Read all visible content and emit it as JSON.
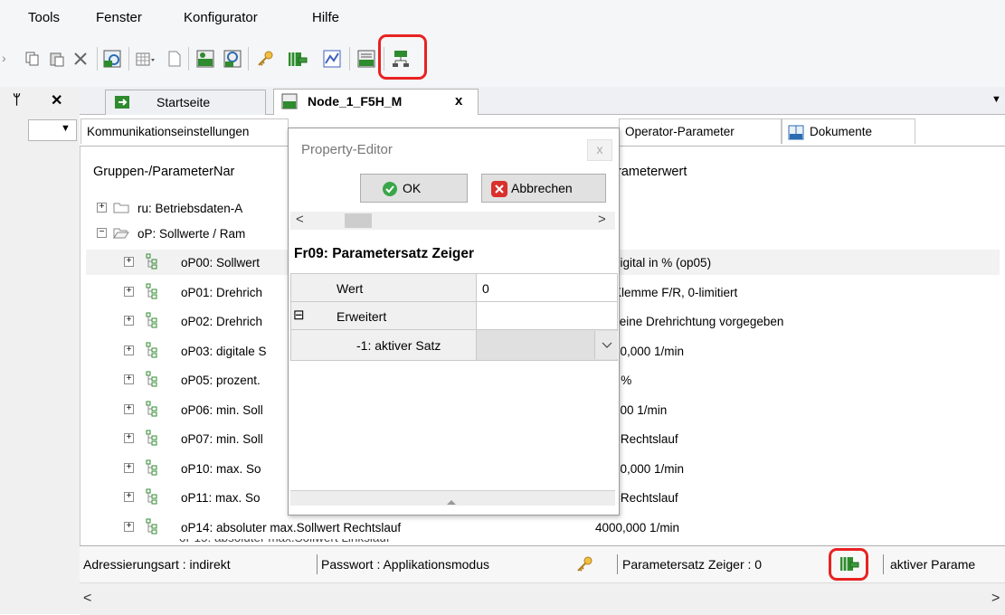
{
  "menu": {
    "items": [
      "Tools",
      "Fenster",
      "Konfigurator",
      "Hilfe"
    ]
  },
  "toolbar": {
    "icons": [
      "copy-icon",
      "paste-icon",
      "delete-icon",
      "keb-parameter-icon",
      "grid-dropdown-icon",
      "document-icon",
      "keb-node-icon",
      "keb-search-icon",
      "key-icon",
      "parameter-set-pointer-icon",
      "chart-icon",
      "keb-list-icon",
      "keb-network-icon"
    ]
  },
  "dock": {
    "pin": "ᛘ",
    "close": "✕",
    "dropdown": "▼"
  },
  "tabs": {
    "startseite": "Startseite",
    "node": "Node_1_F5H_M",
    "node_close": "x",
    "overflow": "▼"
  },
  "subtabs": {
    "kommunikation": "Kommunikationseinstellungen",
    "operator": "Operator-Parameter",
    "dokumente": "Dokumente"
  },
  "tree": {
    "col_name": "Gruppen-/ParameterNar",
    "col_value": "rameterwert",
    "groups": [
      {
        "label": "ru: Betriebsdaten-A",
        "expanded": false
      },
      {
        "label": "oP: Sollwerte / Ram",
        "expanded": true
      }
    ],
    "params": [
      {
        "label": "oP00: Sollwert",
        "value": "digital in % (op05)"
      },
      {
        "label": "oP01: Drehrich",
        "value": "Klemme F/R, 0-limitiert"
      },
      {
        "label": "oP02: Drehrich",
        "value": "keine Drehrichtung vorgegeben"
      },
      {
        "label": "oP03: digitale S",
        "value": "00,000 1/min"
      },
      {
        "label": "oP05: prozent.",
        "value": ") %"
      },
      {
        "label": "oP06: min. Soll",
        "value": "000 1/min"
      },
      {
        "label": "oP07: min. Soll",
        "value": "=Rechtslauf"
      },
      {
        "label": "oP10: max. So",
        "value": "00,000 1/min"
      },
      {
        "label": "oP11: max. So",
        "value": "=Rechtslauf"
      },
      {
        "label": "oP14: absoluter max.Sollwert Rechtslauf",
        "value": "4000,000 1/min"
      }
    ]
  },
  "dialog": {
    "title": "Property-Editor",
    "close": "x",
    "ok": "OK",
    "cancel": "Abbrechen",
    "heading": "Fr09: Parametersatz Zeiger",
    "rows": {
      "wert_label": "Wert",
      "wert_value": "0",
      "erweitert_label": "Erweitert",
      "erweitert_toggle": "⊟",
      "aktiver_label": "-1: aktiver Satz",
      "aktiver_value": ""
    },
    "scroll_left": "<",
    "scroll_right": ">"
  },
  "status": {
    "adressierung": "Adressierungsart  : indirekt",
    "passwort": "Passwort : Applikationsmodus",
    "parametersatz": "Parametersatz Zeiger   : 0",
    "aktiver": "aktiver Parame"
  },
  "colors": {
    "highlight_ring": "#e82222",
    "keb_green": "#2e8b2e",
    "ok_green": "#3aa64a",
    "cancel_red": "#d9302c"
  }
}
